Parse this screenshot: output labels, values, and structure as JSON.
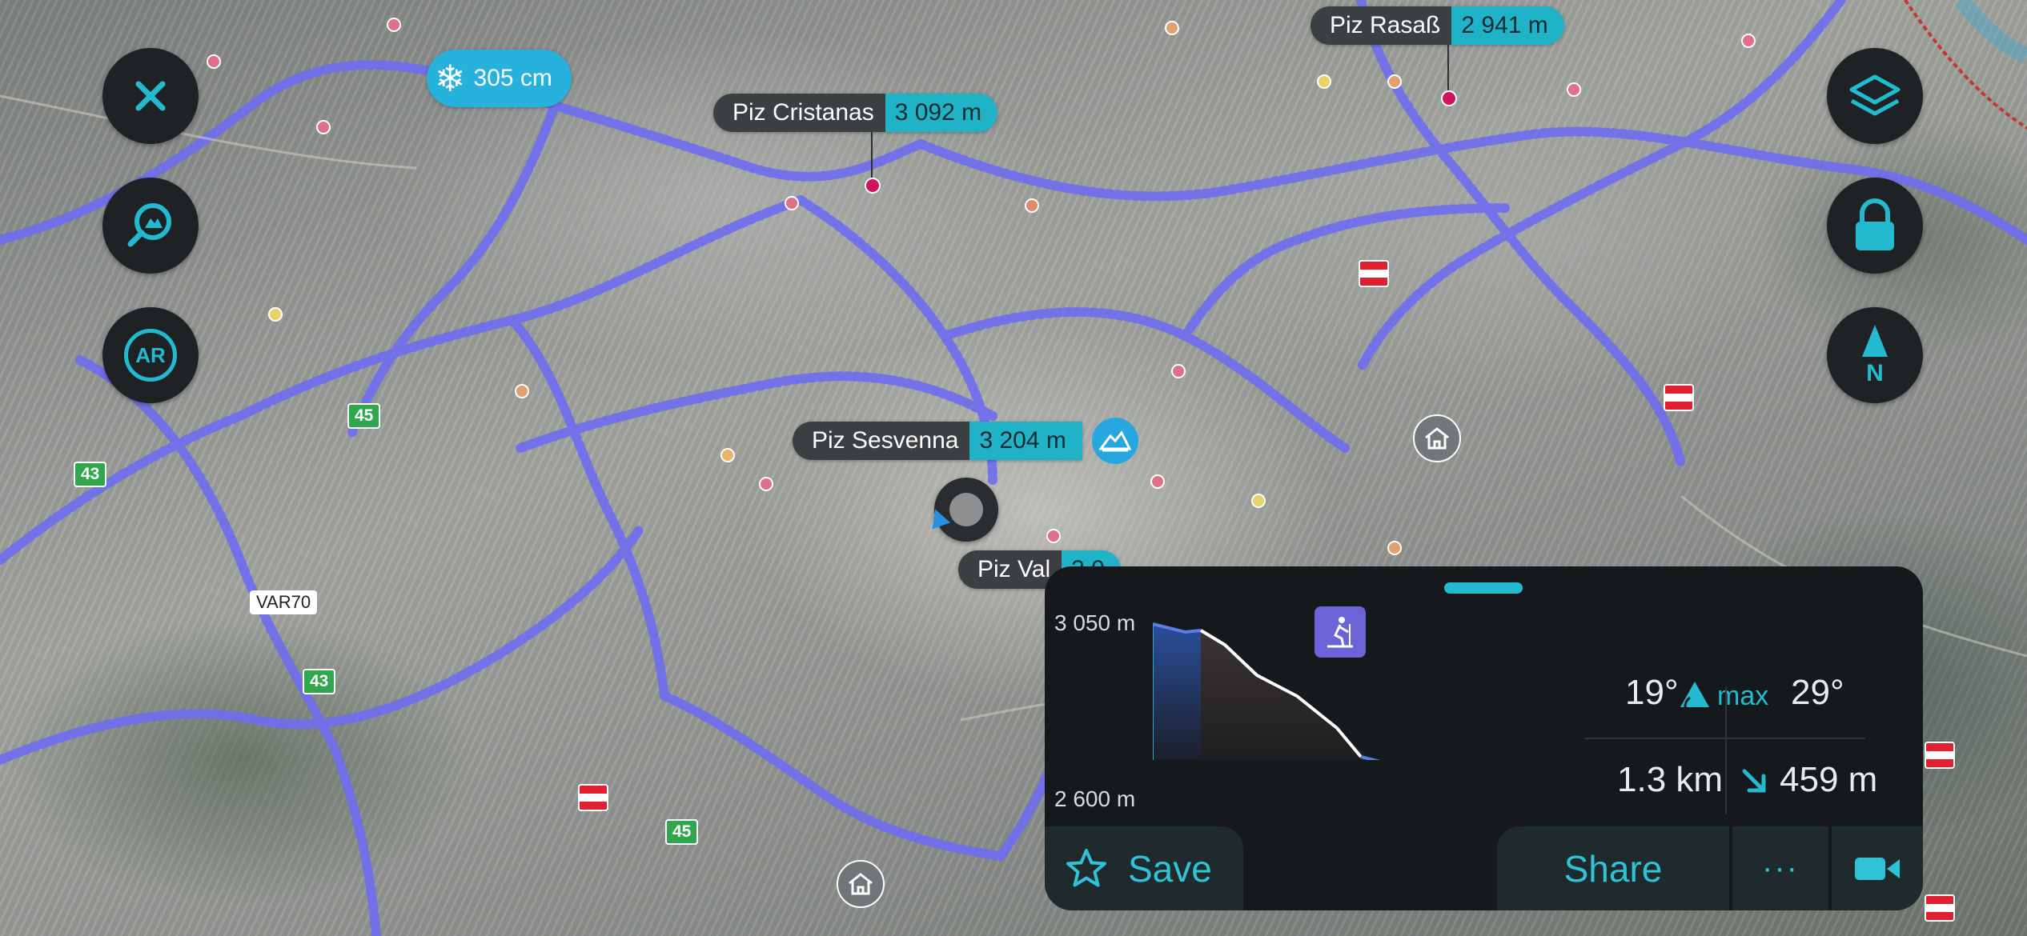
{
  "map": {
    "snow_badge": {
      "icon": "snowflake-icon",
      "value": "305 cm"
    },
    "peaks": [
      {
        "name": "Piz Rasaß",
        "elevation": "2 941 m"
      },
      {
        "name": "Piz Cristanas",
        "elevation": "3 092 m"
      },
      {
        "name": "Piz Sesvenna",
        "elevation": "3 204 m"
      },
      {
        "name": "Piz Val",
        "elevation": "3 0"
      }
    ],
    "route_badges": [
      "45",
      "43",
      "43",
      "45"
    ],
    "road_badge": "VAR70"
  },
  "left_controls": [
    {
      "icon": "close-icon"
    },
    {
      "icon": "search-map-icon"
    },
    {
      "icon": "ar-icon",
      "label": "AR"
    }
  ],
  "right_controls": [
    {
      "icon": "layers-icon"
    },
    {
      "icon": "lock-icon"
    },
    {
      "icon": "compass-icon",
      "label": "N"
    }
  ],
  "panel": {
    "profile": {
      "y_top_label": "3 050 m",
      "y_bottom_label": "2 600 m",
      "activity_icon": "ski-touring-icon"
    },
    "stats": {
      "slope_current": "19°",
      "slope_max_label": "max",
      "slope_max": "29°",
      "distance": "1.3 km",
      "descent": "459 m"
    },
    "buttons": {
      "save": "Save",
      "share": "Share",
      "more": "···"
    }
  },
  "colors": {
    "accent": "#23b9cf",
    "trail": "#6f6df0",
    "panel_bg": "#16191b",
    "button_bg": "#1f2224",
    "peak_marker": "#d0135f"
  }
}
